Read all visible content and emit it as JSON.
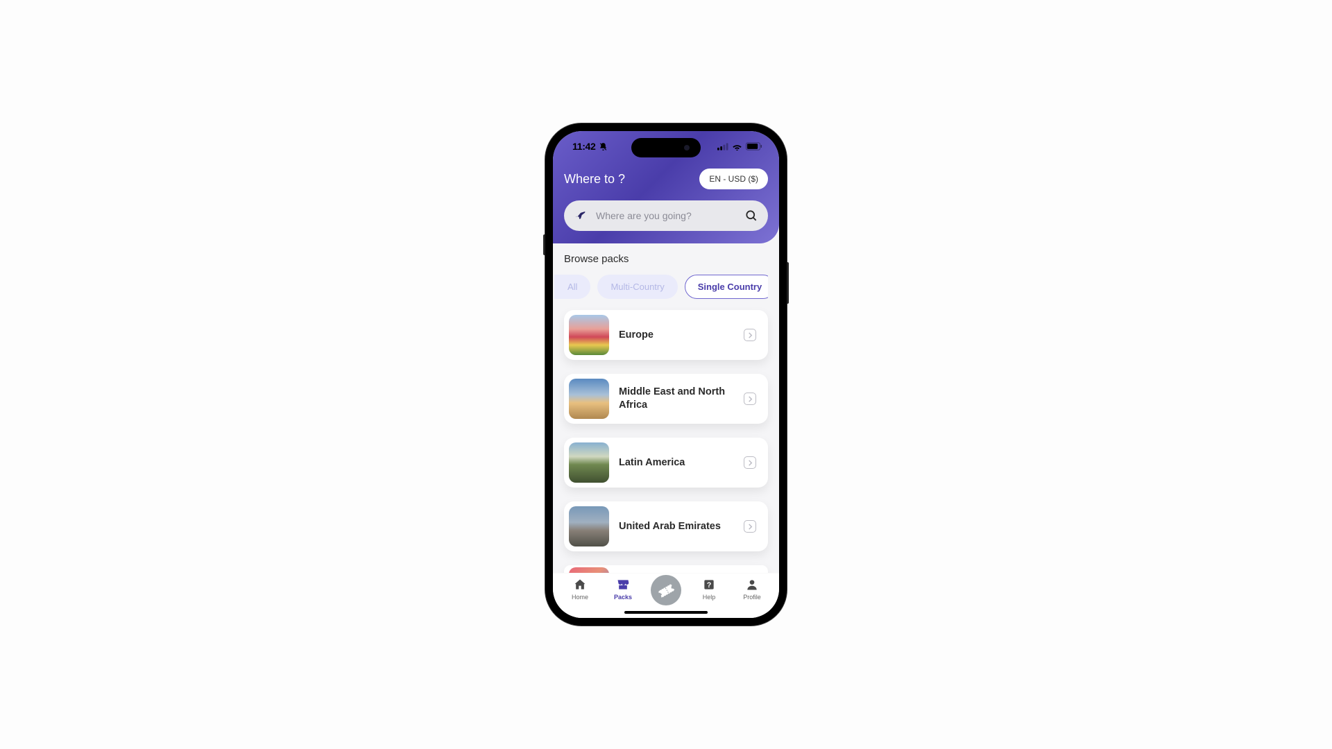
{
  "status": {
    "time": "11:42"
  },
  "header": {
    "title": "Where to ?",
    "locale": "EN - USD ($)"
  },
  "search": {
    "placeholder": "Where are you going?"
  },
  "section_title": "Browse packs",
  "chips": {
    "all": "All",
    "multi": "Multi-Country",
    "single": "Single Country"
  },
  "packs": [
    {
      "title": "Europe"
    },
    {
      "title": "Middle East and North Africa"
    },
    {
      "title": "Latin America"
    },
    {
      "title": "United Arab Emirates"
    }
  ],
  "nav": {
    "home": "Home",
    "packs": "Packs",
    "help": "Help",
    "profile": "Profile"
  }
}
